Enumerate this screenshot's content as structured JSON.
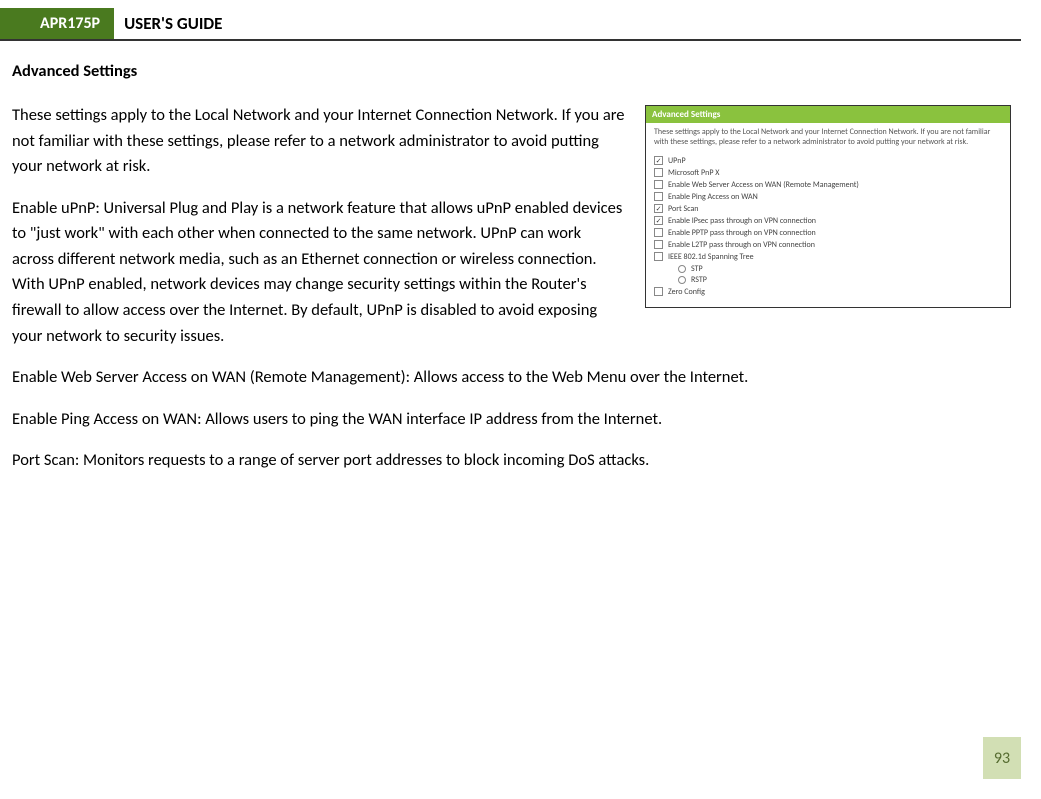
{
  "header": {
    "badge": "APR175P",
    "title": "USER'S GUIDE"
  },
  "section_title": "Advanced Settings",
  "paragraphs": {
    "intro": "These settings apply to the Local Network and your Internet Connection Network.  If you are not familiar with these settings, please refer to a network administrator to avoid putting your network at risk.",
    "upnp": "Enable uPnP: Universal Plug and Play is a network feature that allows uPnP enabled devices to \"just work\" with each other when connected to the same network.  UPnP can work across different network media, such as an Ethernet connection or wireless connection.  With UPnP enabled, network devices may change security settings within the Router's firewall to allow access over the Internet.  By default, UPnP is disabled to avoid exposing your network to security issues.",
    "webserver": "Enable Web Server Access on WAN (Remote Management): Allows access to the Web Menu over the Internet.",
    "ping": "Enable Ping Access on WAN: Allows users to ping the WAN interface IP address from the Internet.",
    "portscan": "Port Scan:  Monitors requests to a range of server port addresses to block incoming DoS attacks."
  },
  "screenshot": {
    "title": "Advanced Settings",
    "desc": "These settings apply to the Local Network and your Internet Connection Network. If you are not familiar with these settings, please refer to a network administrator to avoid putting your network at risk.",
    "items": [
      {
        "checked": true,
        "label": "UPnP"
      },
      {
        "checked": false,
        "label": "Microsoft PnP X"
      },
      {
        "checked": false,
        "label": "Enable Web Server Access on WAN (Remote Management)"
      },
      {
        "checked": false,
        "label": "Enable Ping Access on WAN"
      },
      {
        "checked": true,
        "label": "Port Scan"
      },
      {
        "checked": true,
        "label": "Enable IPsec pass through on VPN connection"
      },
      {
        "checked": false,
        "label": "Enable PPTP pass through on VPN connection"
      },
      {
        "checked": false,
        "label": "Enable L2TP pass through on VPN connection"
      },
      {
        "checked": false,
        "label": "IEEE 802.1d Spanning Tree"
      }
    ],
    "subitems": [
      {
        "label": "STP"
      },
      {
        "label": "RSTP"
      }
    ],
    "last": {
      "checked": false,
      "label": "Zero Config"
    }
  },
  "page_number": "93"
}
